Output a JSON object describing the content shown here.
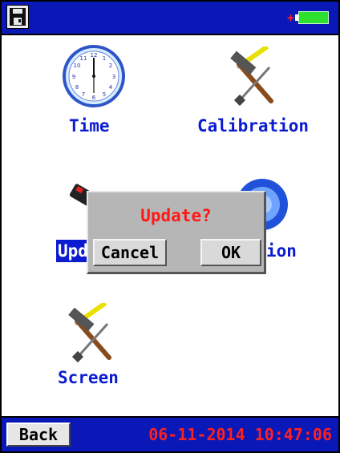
{
  "apps": {
    "time_label": "Time",
    "calibration_label": "Calibration",
    "update_label_visible": "Upd",
    "about_label_visible": "ion",
    "screen_label": "Screen"
  },
  "dialog": {
    "title": "Update?",
    "cancel_label": "Cancel",
    "ok_label": "OK"
  },
  "bottom_bar": {
    "back_label": "Back",
    "datetime": "06-11-2014 10:47:06"
  },
  "status": {
    "charging_symbol": "+"
  },
  "colors": {
    "bar_blue": "#0a18b8",
    "label_blue": "#0b1bd0",
    "alert_red": "#ff2020",
    "battery_green": "#2ee12e",
    "dialog_gray": "#b6b6b6"
  },
  "icons": {
    "save": "floppy-disk-icon",
    "battery": "battery-icon",
    "time": "clock-icon",
    "calibration": "hammer-screwdriver-icon",
    "update": "update-device-icon",
    "about": "info-globe-icon",
    "screen": "hammer-screwdriver-icon"
  }
}
